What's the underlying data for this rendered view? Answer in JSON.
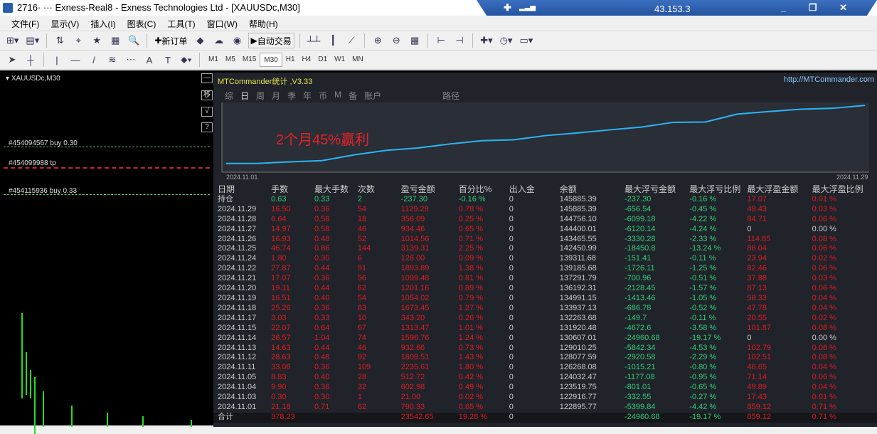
{
  "window": {
    "title": "2716· ··· Exness-Real8 - Exness Technologies Ltd - [XAUUSDc,M30]",
    "remote_ip": "43.153.3",
    "remote_signal": "signal-icon",
    "remote_pin": "pin-icon"
  },
  "menu": [
    "文件(F)",
    "显示(V)",
    "插入(I)",
    "图表(C)",
    "工具(T)",
    "窗口(W)",
    "帮助(H)"
  ],
  "toolbar": {
    "new_order": "新订单",
    "auto_trade": "自动交易"
  },
  "drawing_tools": {
    "text_tool": "A"
  },
  "timeframes": [
    "M1",
    "M5",
    "M15",
    "M30",
    "H1",
    "H4",
    "D1",
    "W1",
    "MN"
  ],
  "timeframe_active": "M30",
  "chart": {
    "symbol": "XAUUSDc,M30",
    "orders": [
      "#454094567 buy 0.30",
      "#454099988 tp",
      "#454115936 buy 0.33"
    ],
    "side_buttons": [
      "—",
      "移",
      "√",
      "?"
    ]
  },
  "panel": {
    "title": "MTCommander统计 ,V3.33",
    "url": "http://MTCommander.com",
    "tabs": [
      "综",
      "日",
      "周",
      "月",
      "季",
      "年",
      "币",
      "M",
      "备",
      "账户",
      "路径"
    ],
    "active_tab": "日",
    "annotation": "2个月45%赢利",
    "equity_start_label": "2024.11.01",
    "equity_end_label": "2024.11.29",
    "line_color": "#29b6f6",
    "columns": [
      "日期",
      "手数",
      "最大手数",
      "次数",
      "盈亏金额",
      "百分比%",
      "出入金",
      "余额",
      "最大浮亏金额",
      "最大浮亏比例",
      "最大浮盈金额",
      "最大浮盈比例"
    ],
    "rows": [
      [
        "持仓",
        "0.63",
        "0.33",
        "2",
        "-237.30",
        "-0.16 %",
        "0",
        "145885.39",
        "-237.30",
        "-0.16 %",
        "17.07",
        "0.01 %"
      ],
      [
        "2024.11.29",
        "16.50",
        "0.36",
        "54",
        "1129.29",
        "0.78 %",
        "0",
        "145885.39",
        "-656.54",
        "-0.45 %",
        "49.43",
        "0.03 %"
      ],
      [
        "2024.11.28",
        "6.64",
        "0.58",
        "18",
        "356.09",
        "0.25 %",
        "0",
        "144756.10",
        "-6099.18",
        "-4.22 %",
        "84.71",
        "0.06 %"
      ],
      [
        "2024.11.27",
        "14.97",
        "0.58",
        "46",
        "934.46",
        "0.65 %",
        "0",
        "144400.01",
        "-6120.14",
        "-4.24 %",
        "0",
        "0.00 %"
      ],
      [
        "2024.11.26",
        "16.93",
        "0.48",
        "52",
        "1014.56",
        "0.71 %",
        "0",
        "143465.55",
        "-3330.28",
        "-2.33 %",
        "114.85",
        "0.08 %"
      ],
      [
        "2024.11.25",
        "46.74",
        "0.86",
        "144",
        "3139.31",
        "2.25 %",
        "0",
        "142450.99",
        "-18450.8",
        "-13.24 %",
        "86.04",
        "0.06 %"
      ],
      [
        "2024.11.24",
        "1.80",
        "0.30",
        "6",
        "126.00",
        "0.09 %",
        "0",
        "139311.68",
        "-151.41",
        "-0.11 %",
        "23.94",
        "0.02 %"
      ],
      [
        "2024.11.22",
        "27.87",
        "0.44",
        "91",
        "1893.89",
        "1.38 %",
        "0",
        "139185.68",
        "-1726.11",
        "-1.25 %",
        "82.46",
        "0.06 %"
      ],
      [
        "2024.11.21",
        "17.07",
        "0.36",
        "56",
        "1099.48",
        "0.81 %",
        "0",
        "137291.79",
        "-700.96",
        "-0.51 %",
        "37.88",
        "0.03 %"
      ],
      [
        "2024.11.20",
        "19.11",
        "0.44",
        "62",
        "1201.16",
        "0.89 %",
        "0",
        "136192.31",
        "-2128.45",
        "-1.57 %",
        "87.13",
        "0.06 %"
      ],
      [
        "2024.11.19",
        "16.51",
        "0.40",
        "54",
        "1054.02",
        "0.79 %",
        "0",
        "134991.15",
        "-1413.46",
        "-1.05 %",
        "58.33",
        "0.04 %"
      ],
      [
        "2024.11.18",
        "25.26",
        "0.36",
        "83",
        "1673.45",
        "1.27 %",
        "0",
        "133937.13",
        "-686.78",
        "-0.52 %",
        "47.78",
        "0.04 %"
      ],
      [
        "2024.11.17",
        "3.03",
        "0.33",
        "10",
        "343.20",
        "0.26 %",
        "0",
        "132263.68",
        "-149.7",
        "-0.11 %",
        "20.55",
        "0.02 %"
      ],
      [
        "2024.11.15",
        "22.07",
        "0.64",
        "67",
        "1313.47",
        "1.01 %",
        "0",
        "131920.48",
        "-4672.6",
        "-3.58 %",
        "101.87",
        "0.08 %"
      ],
      [
        "2024.11.14",
        "26.57",
        "1.04",
        "74",
        "1596.76",
        "1.24 %",
        "0",
        "130607.01",
        "-24960.68",
        "-19.17 %",
        "0",
        "0.00 %"
      ],
      [
        "2024.11.13",
        "14.63",
        "0.44",
        "46",
        "932.66",
        "0.73 %",
        "0",
        "129010.25",
        "-5842.34",
        "-4.53 %",
        "102.79",
        "0.08 %"
      ],
      [
        "2024.11.12",
        "28.63",
        "0.48",
        "92",
        "1809.51",
        "1.43 %",
        "0",
        "128077.59",
        "-2920.58",
        "-2.29 %",
        "102.51",
        "0.08 %"
      ],
      [
        "2024.11.11",
        "33.06",
        "0.36",
        "109",
        "2235.61",
        "1.80 %",
        "0",
        "126268.08",
        "-1015.21",
        "-0.80 %",
        "46.65",
        "0.04 %"
      ],
      [
        "2024.11.05",
        "8.83",
        "0.40",
        "28",
        "512.72",
        "0.42 %",
        "0",
        "124032.47",
        "-1177.08",
        "-0.95 %",
        "71.14",
        "0.06 %"
      ],
      [
        "2024.11.04",
        "9.90",
        "0.36",
        "32",
        "602.98",
        "0.49 %",
        "0",
        "123519.75",
        "-801.01",
        "-0.65 %",
        "49.89",
        "0.04 %"
      ],
      [
        "2024.11.03",
        "0.30",
        "0.30",
        "1",
        "21.00",
        "0.02 %",
        "0",
        "122916.77",
        "-332.55",
        "-0.27 %",
        "17.43",
        "0.01 %"
      ],
      [
        "2024.11.01",
        "21.18",
        "0.71",
        "62",
        "790.33",
        "0.65 %",
        "0",
        "122895.77",
        "-5399.84",
        "-4.42 %",
        "859.12",
        "0.71 %"
      ]
    ],
    "total": [
      "合计",
      "378.23",
      "",
      "",
      "23542.65",
      "19.28 %",
      "0",
      "",
      "-24960.68",
      "-19.17 %",
      "859.12",
      "0.71 %"
    ]
  }
}
